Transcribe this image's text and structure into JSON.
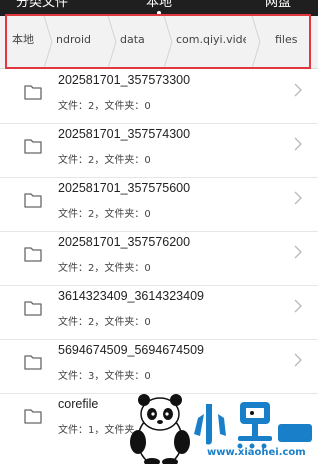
{
  "header": {
    "tabs": [
      {
        "label": "分类文件"
      },
      {
        "label": "本地"
      },
      {
        "label": "网盘"
      }
    ]
  },
  "breadcrumb": [
    "本地",
    "ndroid",
    "data",
    "com.qiyi.video",
    "files"
  ],
  "files": [
    {
      "name": "202581701_357573300",
      "meta": "文件：2，文件夹：0"
    },
    {
      "name": "202581701_357574300",
      "meta": "文件：2，文件夹：0"
    },
    {
      "name": "202581701_357575600",
      "meta": "文件：2，文件夹：0"
    },
    {
      "name": "202581701_357576200",
      "meta": "文件：2，文件夹：0"
    },
    {
      "name": "3614323409_3614323409",
      "meta": "文件：2，文件夹：0"
    },
    {
      "name": "5694674509_5694674509",
      "meta": "文件：3，文件夹：0"
    },
    {
      "name": "corefile",
      "meta": "文件：1，文件夹"
    }
  ],
  "watermark": {
    "title": "小黑游戏",
    "url": "www.xiaohei.com"
  },
  "colors": {
    "highlight": "#e0383e",
    "watermark_blue": "#1a7fc9"
  },
  "icons": {
    "folder": "folder-icon",
    "chevron": "chevron-right-icon",
    "separator": "chevron-separator"
  }
}
